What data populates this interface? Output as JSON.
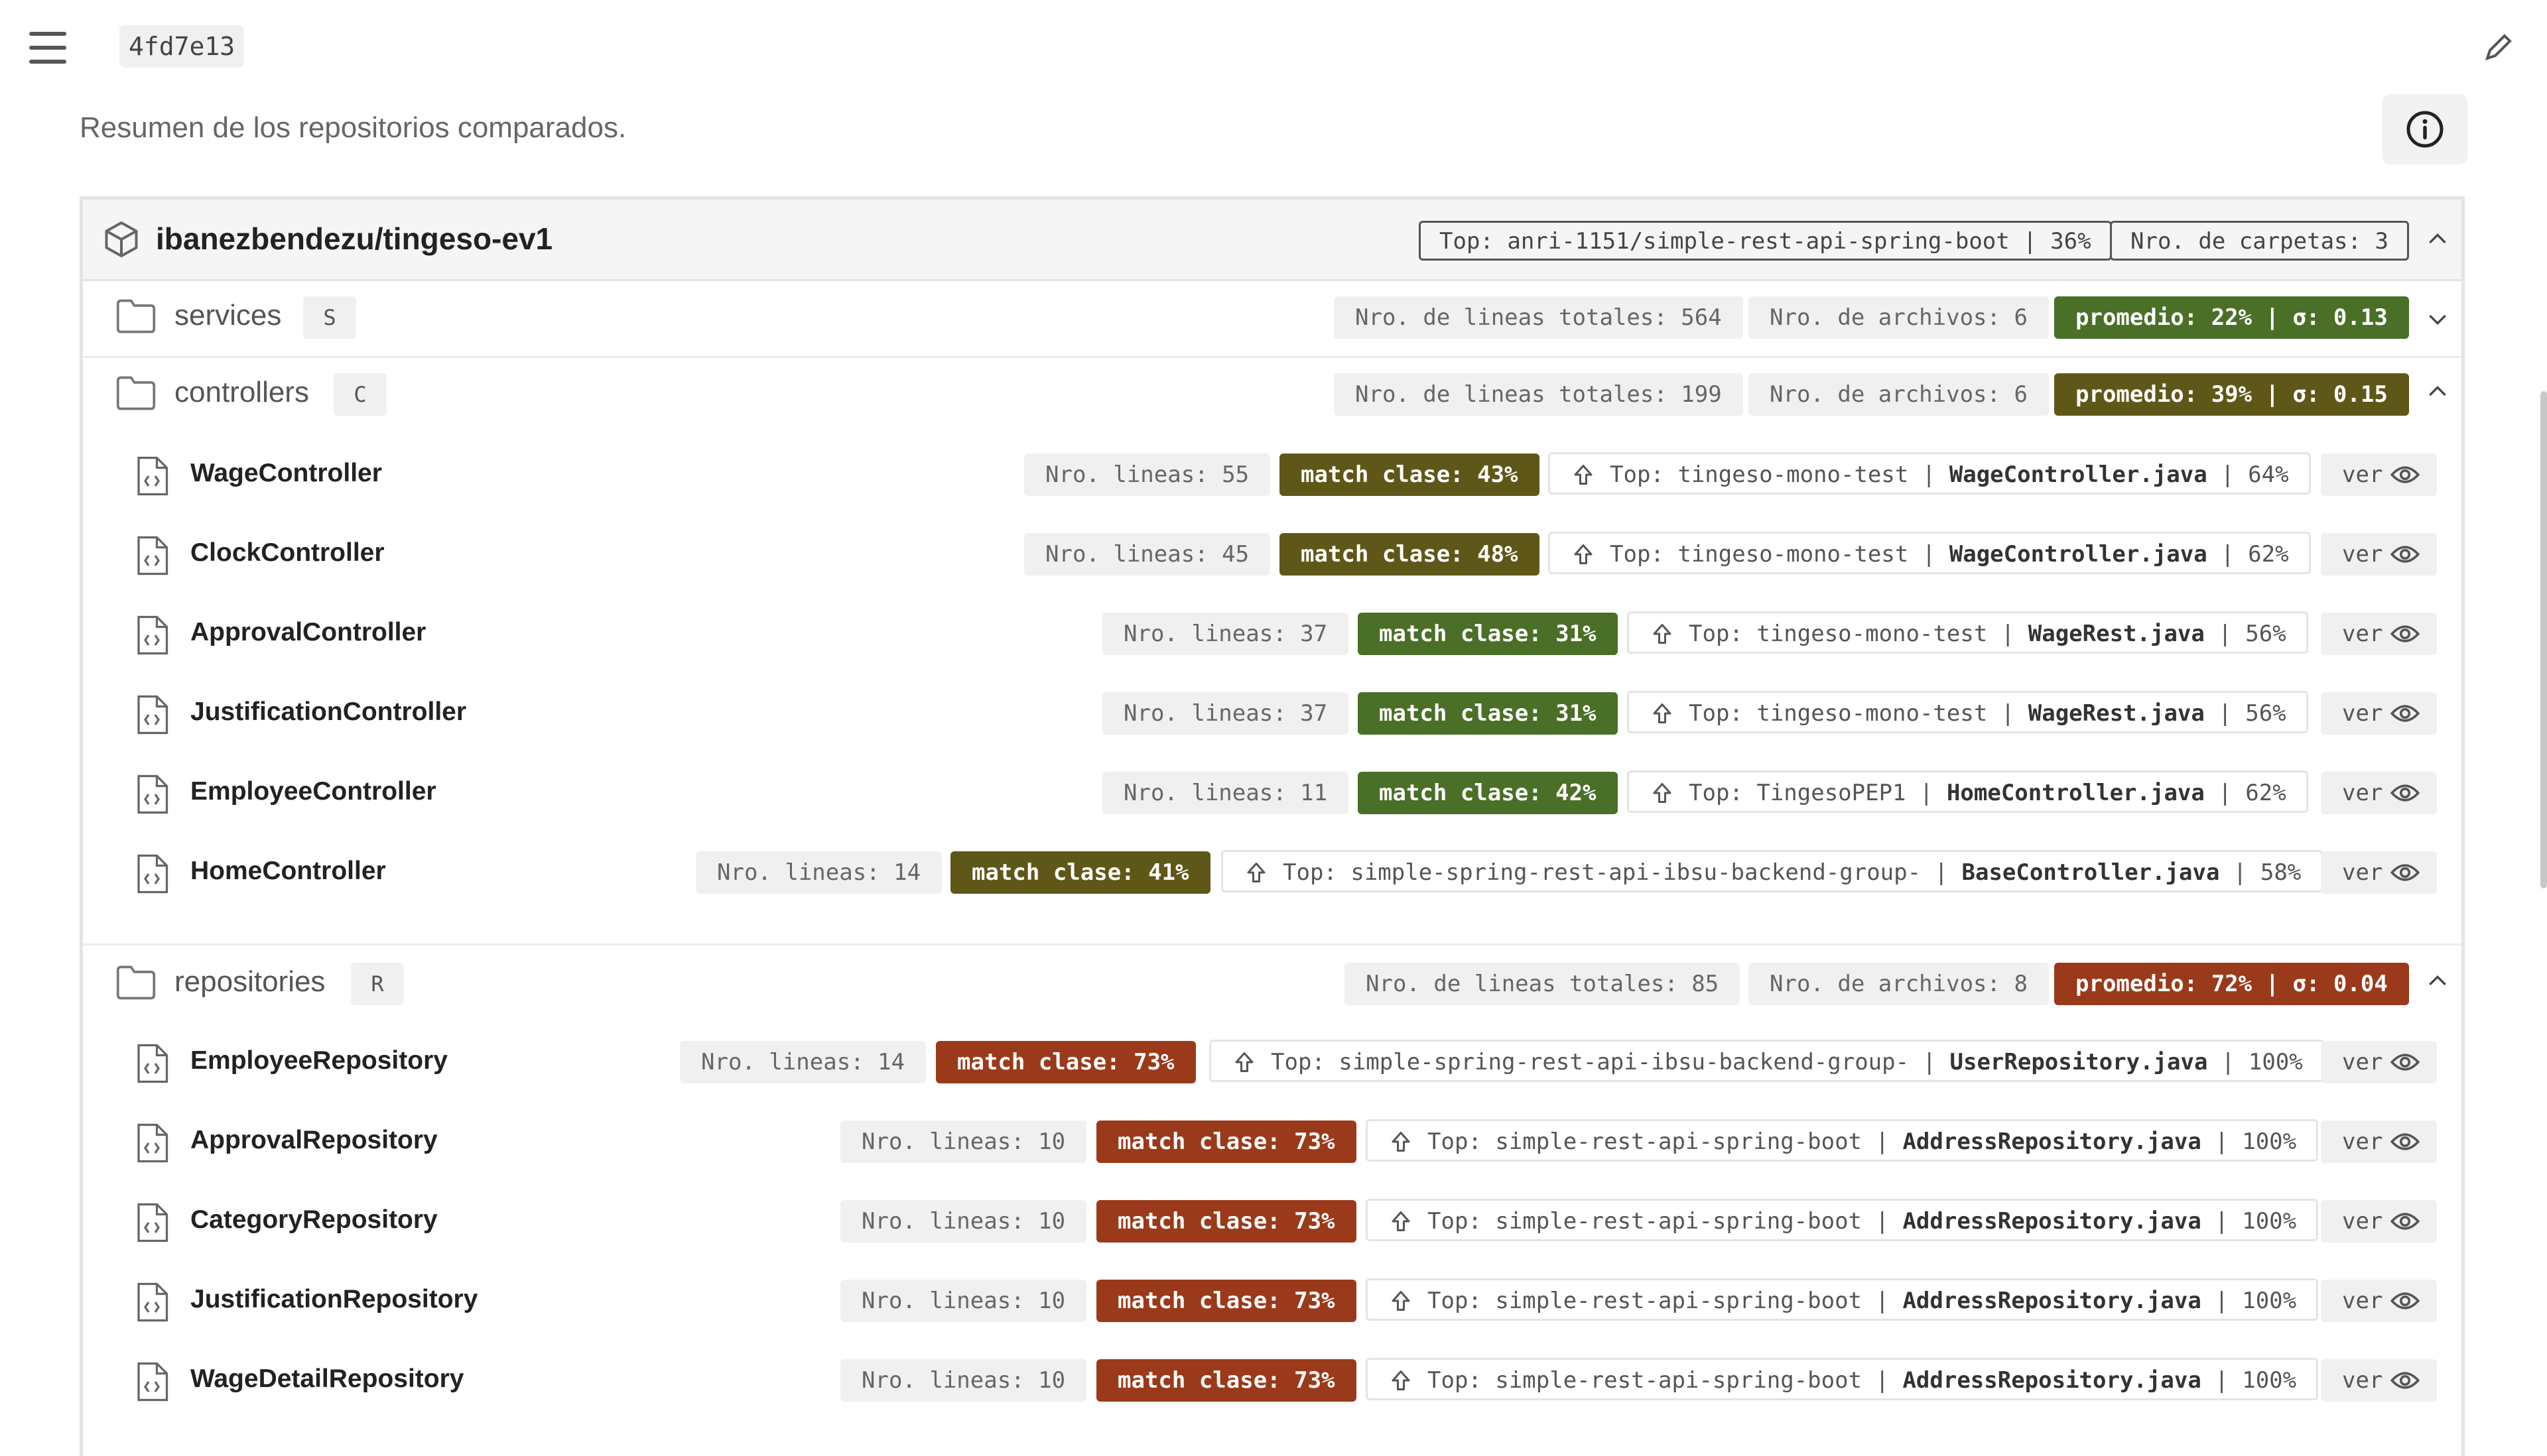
{
  "header": {
    "commit": "4fd7e13"
  },
  "summary": "Resumen de los repositorios comparados.",
  "colors": {
    "green": "#4a6f27",
    "olive": "#5f5718",
    "red": "#9a3a1a"
  },
  "repo": {
    "name": "ibanezbendezu/tingeso-ev1",
    "top_badge": "Top: anri-1151/simple-rest-api-spring-boot | 36%",
    "folders_badge": "Nro. de carpetas: 3"
  },
  "folders": [
    {
      "name": "services",
      "letter": "S",
      "lines": "Nro. de lineas totales: 564",
      "files": "Nro. de archivos: 6",
      "avg": "promedio: 22% | σ: 0.13",
      "color": "green"
    },
    {
      "name": "controllers",
      "letter": "C",
      "lines": "Nro. de lineas totales: 199",
      "files": "Nro. de archivos: 6",
      "avg": "promedio: 39% | σ: 0.15",
      "color": "olive"
    },
    {
      "name": "repositories",
      "letter": "R",
      "lines": "Nro. de lineas totales: 85",
      "files": "Nro. de archivos: 8",
      "avg": "promedio: 72% | σ: 0.04",
      "color": "red"
    }
  ],
  "controller_files": [
    {
      "name": "WageController",
      "lines": "Nro. lineas: 55",
      "match": "match clase: 43%",
      "top_repo": "Top: tingeso-mono-test",
      "top_file": "WageController.java",
      "top_pct": "64%",
      "ver": "ver"
    },
    {
      "name": "ClockController",
      "lines": "Nro. lineas: 45",
      "match": "match clase: 48%",
      "top_repo": "Top: tingeso-mono-test",
      "top_file": "WageController.java",
      "top_pct": "62%",
      "ver": "ver"
    },
    {
      "name": "ApprovalController",
      "lines": "Nro. lineas: 37",
      "match": "match clase: 31%",
      "top_repo": "Top: tingeso-mono-test",
      "top_file": "WageRest.java",
      "top_pct": "56%",
      "ver": "ver"
    },
    {
      "name": "JustificationController",
      "lines": "Nro. lineas: 37",
      "match": "match clase: 31%",
      "top_repo": "Top: tingeso-mono-test",
      "top_file": "WageRest.java",
      "top_pct": "56%",
      "ver": "ver"
    },
    {
      "name": "EmployeeController",
      "lines": "Nro. lineas: 11",
      "match": "match clase: 42%",
      "top_repo": "Top: TingesoPEP1",
      "top_file": "HomeController.java",
      "top_pct": "62%",
      "ver": "ver"
    },
    {
      "name": "HomeController",
      "lines": "Nro. lineas: 14",
      "match": "match clase: 41%",
      "top_repo": "Top: simple-spring-rest-api-ibsu-backend-group-",
      "top_file": "BaseController.java",
      "top_pct": "58%",
      "ver": "ver"
    }
  ],
  "repository_files": [
    {
      "name": "EmployeeRepository",
      "lines": "Nro. lineas: 14",
      "match": "match clase: 73%",
      "top_repo": "Top: simple-spring-rest-api-ibsu-backend-group-",
      "top_file": "UserRepository.java",
      "top_pct": "100%",
      "ver": "ver"
    },
    {
      "name": "ApprovalRepository",
      "lines": "Nro. lineas: 10",
      "match": "match clase: 73%",
      "top_repo": "Top: simple-rest-api-spring-boot",
      "top_file": "AddressRepository.java",
      "top_pct": "100%",
      "ver": "ver"
    },
    {
      "name": "CategoryRepository",
      "lines": "Nro. lineas: 10",
      "match": "match clase: 73%",
      "top_repo": "Top: simple-rest-api-spring-boot",
      "top_file": "AddressRepository.java",
      "top_pct": "100%",
      "ver": "ver"
    },
    {
      "name": "JustificationRepository",
      "lines": "Nro. lineas: 10",
      "match": "match clase: 73%",
      "top_repo": "Top: simple-rest-api-spring-boot",
      "top_file": "AddressRepository.java",
      "top_pct": "100%",
      "ver": "ver"
    },
    {
      "name": "WageDetailRepository",
      "lines": "Nro. lineas: 10",
      "match": "match clase: 73%",
      "top_repo": "Top: simple-rest-api-spring-boot",
      "top_file": "AddressRepository.java",
      "top_pct": "100%",
      "ver": "ver"
    }
  ]
}
